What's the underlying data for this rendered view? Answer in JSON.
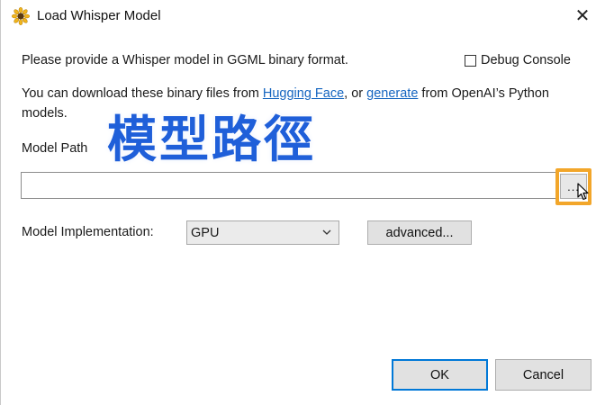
{
  "window": {
    "title": "Load Whisper Model",
    "close_glyph": "✕"
  },
  "content": {
    "instruction": "Please provide a Whisper model in GGML binary format.",
    "download_line1_prefix": "You can download these binary files from ",
    "hugging_face_link": "Hugging Face",
    "download_line1_middle": ", or ",
    "generate_link": "generate",
    "download_line1_suffix": " from OpenAI’s Python",
    "download_line2": "models.",
    "debug_console_label": "Debug Console",
    "debug_console_checked": false,
    "model_path_label": "Model Path",
    "model_path_value": "",
    "browse_button_label": "...",
    "model_impl_label": "Model Implementation:",
    "model_impl_selected": "GPU",
    "advanced_button_label": "advanced...",
    "ok_button_label": "OK",
    "cancel_button_label": "Cancel"
  },
  "overlay": {
    "caption": "模型路徑"
  },
  "colors": {
    "link": "#1565c0",
    "overlay_text": "#1f5fd9",
    "highlight_box": "#f2a62a",
    "ok_focus": "#0078d7"
  },
  "icons": {
    "app_icon": "sunflower-icon",
    "close": "close-icon",
    "dropdown": "chevron-down-icon",
    "pointer": "mouse-cursor-icon"
  }
}
